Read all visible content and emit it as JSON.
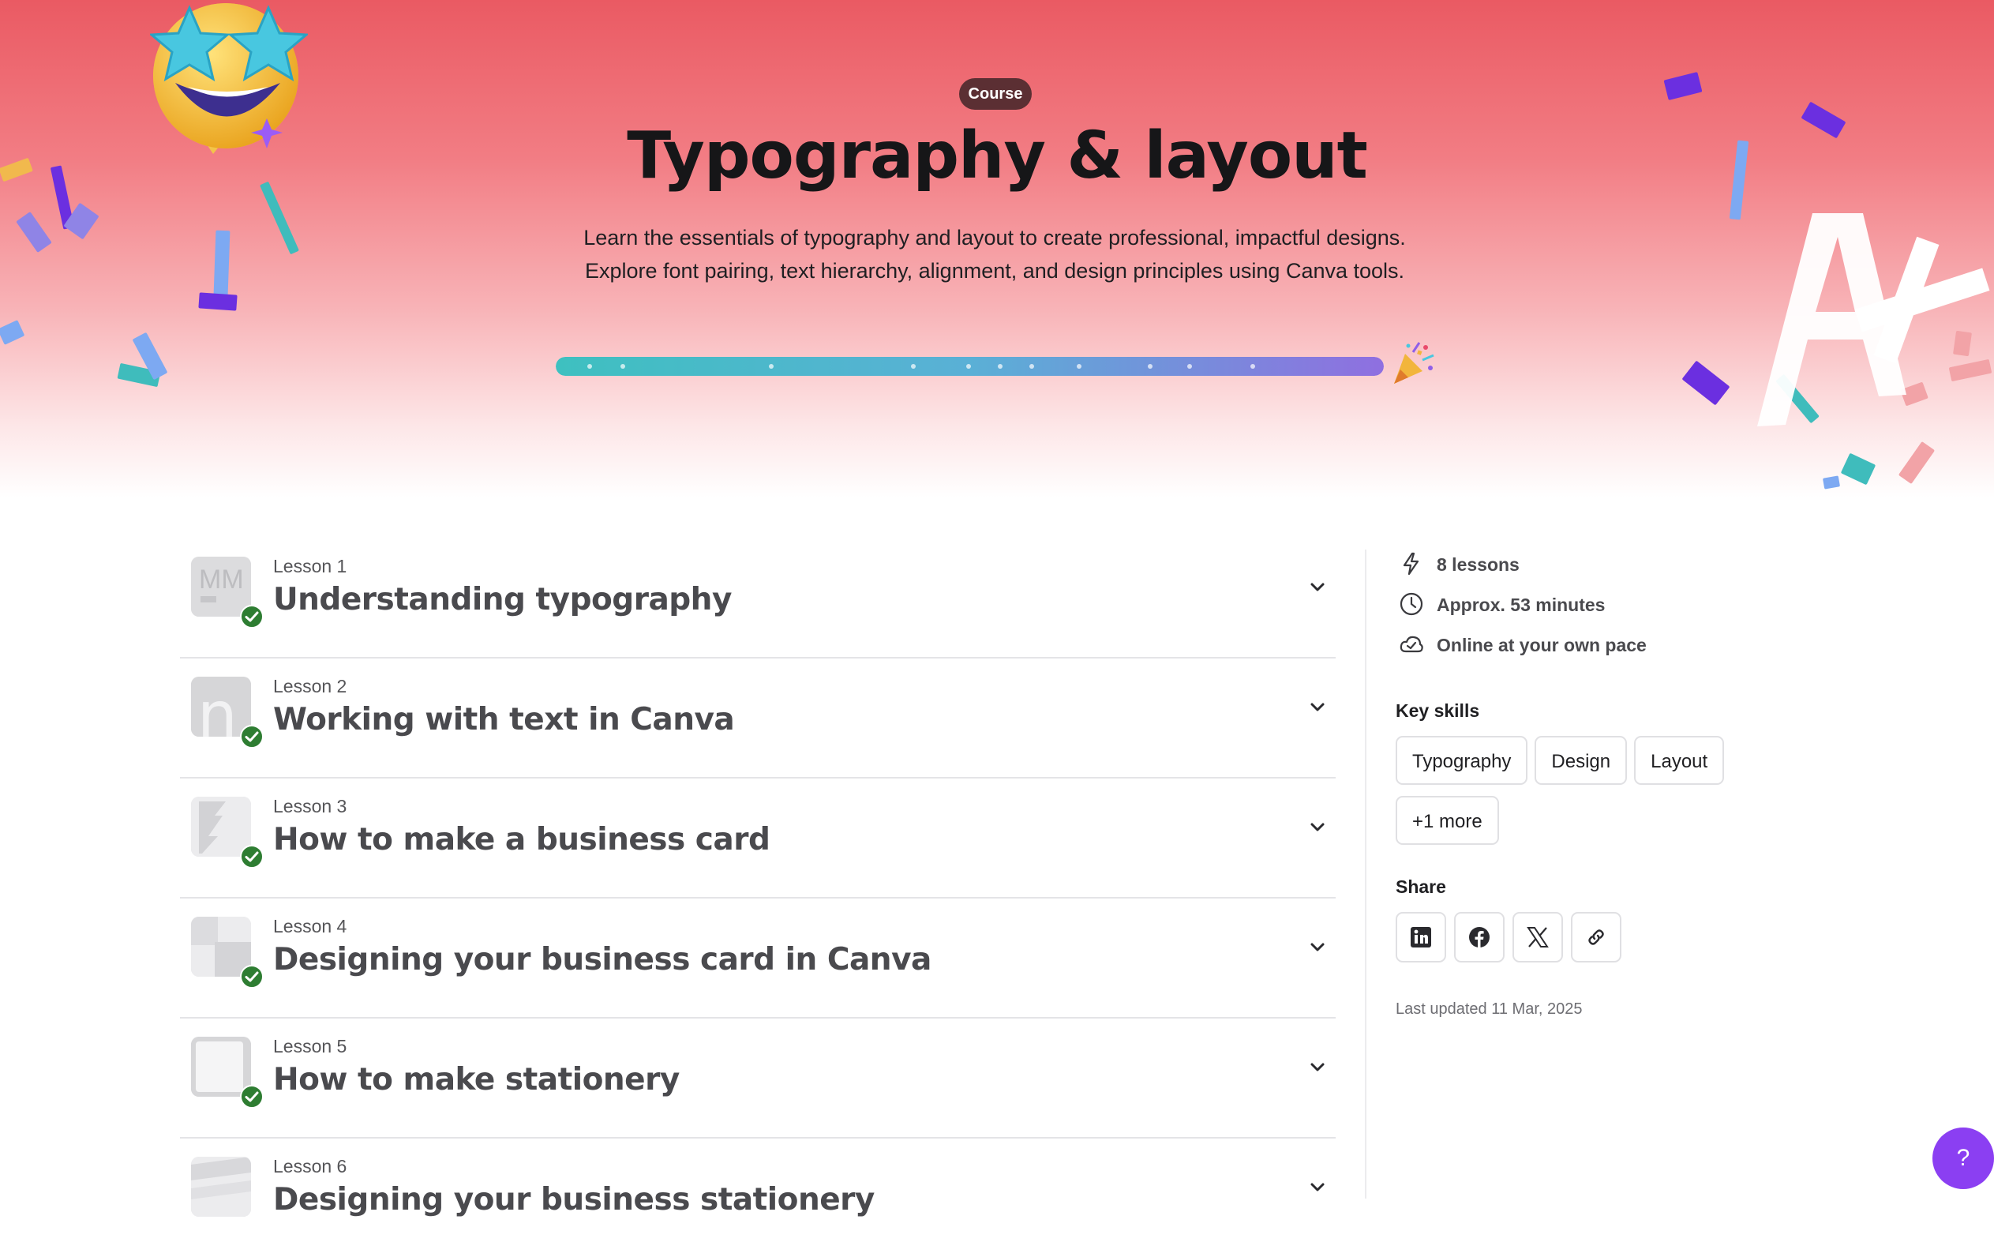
{
  "hero": {
    "badge": "Course",
    "title": "Typography & layout",
    "description_line1": "Learn the essentials of typography and layout to create professional, impactful designs.",
    "description_line2": "Explore font pairing, text hierarchy, alignment, and design principles using Canva tools.",
    "progress_percent": 100,
    "progress_colors": [
      "#3ec0c0",
      "#5ab0d6",
      "#8f6fe0"
    ],
    "icons": [
      "star-eyes-emoji-icon",
      "party-popper-icon",
      "a-plus-icon"
    ]
  },
  "lessons": [
    {
      "number": "Lesson 1",
      "title": "Understanding typography",
      "completed": true,
      "thumb": "typography-thumb"
    },
    {
      "number": "Lesson 2",
      "title": "Working with text in Canva",
      "completed": true,
      "thumb": "letter-n-thumb"
    },
    {
      "number": "Lesson 3",
      "title": "How to make a business card",
      "completed": true,
      "thumb": "card-thumb"
    },
    {
      "number": "Lesson 4",
      "title": "Designing your business card in Canva",
      "completed": true,
      "thumb": "card-design-thumb"
    },
    {
      "number": "Lesson 5",
      "title": "How to make stationery",
      "completed": true,
      "thumb": "stationery-thumb"
    },
    {
      "number": "Lesson 6",
      "title": "Designing your business stationery",
      "completed": false,
      "thumb": "stationery-design-thumb"
    }
  ],
  "sidebar": {
    "lesson_count": "8 lessons",
    "duration": "Approx. 53 minutes",
    "pace": "Online at your own pace",
    "key_skills_label": "Key skills",
    "skills": [
      "Typography",
      "Design",
      "Layout"
    ],
    "more_skills": "+1 more",
    "share_label": "Share",
    "share_icons": [
      "linkedin-icon",
      "facebook-icon",
      "x-icon",
      "link-icon"
    ],
    "last_updated": "Last updated 11 Mar, 2025"
  },
  "help": {
    "label": "?"
  },
  "colors": {
    "hero_top": "#ea5a63",
    "check_green": "#2e7d32",
    "help_purple": "#8b3ff2",
    "badge_bg": "#5b2f33"
  }
}
